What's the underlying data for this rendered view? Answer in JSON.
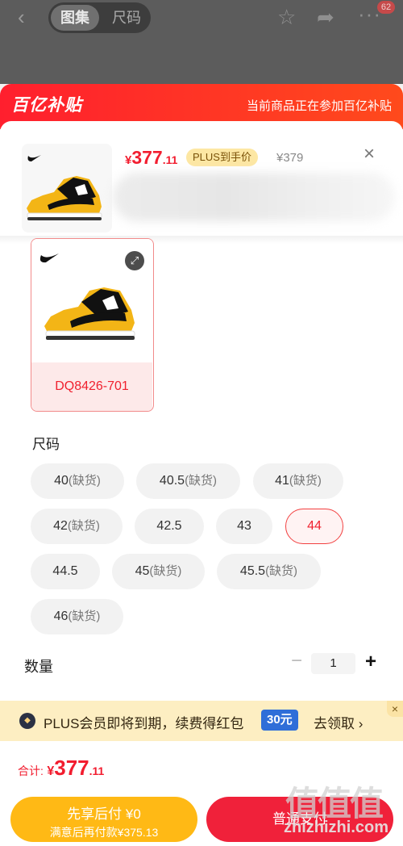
{
  "topbar": {
    "tabs": [
      "图集",
      "尺码"
    ],
    "active_tab": "图集",
    "badge_count": "62"
  },
  "banner": {
    "logo": "百亿补贴",
    "text": "当前商品正在参加百亿补贴"
  },
  "product": {
    "price_currency": "¥",
    "price_int": "377",
    "price_dec": ".11",
    "plus_tag": "PLUS到手价",
    "original_price": "¥379"
  },
  "sku": {
    "selected_label": "DQ8426-701"
  },
  "size": {
    "title": "尺码",
    "options": [
      {
        "size": "40",
        "status": "(缺货)"
      },
      {
        "size": "40.5",
        "status": "(缺货)"
      },
      {
        "size": "41",
        "status": "(缺货)"
      },
      {
        "size": "42",
        "status": "(缺货)"
      },
      {
        "size": "42.5",
        "status": ""
      },
      {
        "size": "43",
        "status": ""
      },
      {
        "size": "44",
        "status": "",
        "selected": true
      },
      {
        "size": "44.5",
        "status": ""
      },
      {
        "size": "45",
        "status": "(缺货)"
      },
      {
        "size": "45.5",
        "status": "(缺货)"
      },
      {
        "size": "46",
        "status": "(缺货)"
      }
    ]
  },
  "quantity": {
    "label": "数量",
    "value": "1"
  },
  "promo": {
    "text": "PLUS会员即将到期，续费得红包",
    "amount": "30元",
    "claim": "去领取 ›"
  },
  "checkout": {
    "total_label": "合计:",
    "total_currency": "¥",
    "total_int": "377",
    "total_dec": ".11",
    "pay_later_label": "先享后付 ¥0",
    "pay_later_sub": "满意后再付款¥375.13",
    "buy_label": "普通支付"
  },
  "watermark": {
    "url": "zhizhizhi.com"
  },
  "colors": {
    "accent_red": "#f21d2f",
    "plus_gold": "#fde7a3",
    "pay_later_yellow": "#ffb915"
  }
}
